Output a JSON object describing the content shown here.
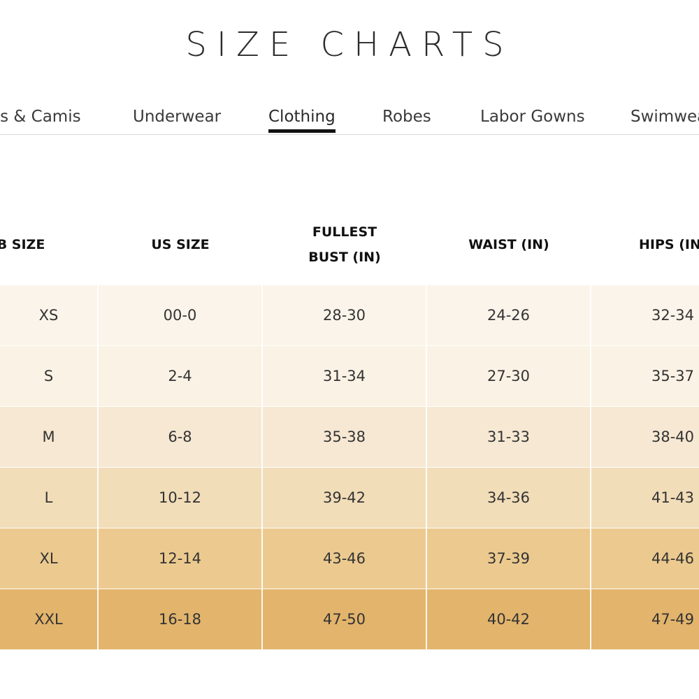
{
  "page": {
    "title": "SIZE CHARTS"
  },
  "tabs": [
    {
      "label": "as & Camis"
    },
    {
      "label": "Underwear"
    },
    {
      "label": "Clothing"
    },
    {
      "label": "Robes"
    },
    {
      "label": "Labor Gowns"
    },
    {
      "label": "Swimwea"
    }
  ],
  "table": {
    "headers": [
      {
        "line1": "B SIZE",
        "line2": ""
      },
      {
        "line1": "US SIZE",
        "line2": ""
      },
      {
        "line1": "FULLEST",
        "line2": "BUST (IN)"
      },
      {
        "line1": "WAIST (IN)",
        "line2": ""
      },
      {
        "line1": "HIPS (IN",
        "line2": ""
      }
    ],
    "rows": [
      {
        "color": "#fbf4ea",
        "cells": [
          "XS",
          "00-0",
          "28-30",
          "24-26",
          "32-34"
        ]
      },
      {
        "color": "#faf2e5",
        "cells": [
          "S",
          "2-4",
          "31-34",
          "27-30",
          "35-37"
        ]
      },
      {
        "color": "#f6e8d3",
        "cells": [
          "M",
          "6-8",
          "35-38",
          "31-33",
          "38-40"
        ]
      },
      {
        "color": "#f2ddb9",
        "cells": [
          "L",
          "10-12",
          "39-42",
          "34-36",
          "41-43"
        ]
      },
      {
        "color": "#ecca8f",
        "cells": [
          "XL",
          "12-14",
          "43-46",
          "37-39",
          "44-46"
        ]
      },
      {
        "color": "#e2b46c",
        "cells": [
          "XXL",
          "16-18",
          "47-50",
          "40-42",
          "47-49"
        ]
      }
    ]
  }
}
